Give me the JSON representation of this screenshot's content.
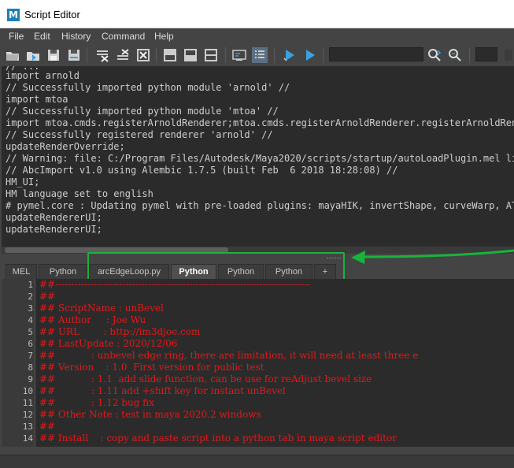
{
  "window": {
    "title": "Script Editor",
    "app_icon": "M"
  },
  "menu": [
    "File",
    "Edit",
    "History",
    "Command",
    "Help"
  ],
  "toolbar": {
    "icons": [
      "open-script-icon",
      "source-script-icon",
      "save-script-icon",
      "save-to-shelf-icon",
      "clear-history-icon",
      "clear-input-icon",
      "clear-all-icon",
      "show-history-icon",
      "show-input-icon",
      "show-both-icon",
      "echo-all-commands-icon",
      "line-numbers-icon",
      "execute-all-icon",
      "execute-icon",
      "search-icon",
      "search-next-icon"
    ],
    "search_value": "",
    "goto_value": ""
  },
  "output_lines": [
    "// ...",
    "import arnold",
    "// Successfully imported python module 'arnold' //",
    "import mtoa",
    "// Successfully imported python module 'mtoa' //",
    "import mtoa.cmds.registerArnoldRenderer;mtoa.cmds.registerArnoldRenderer.registerArnoldRender",
    "// Successfully registered renderer 'arnold' //",
    "updateRenderOverride;",
    "// Warning: file: C:/Program Files/Autodesk/Maya2020/scripts/startup/autoLoadPlugin.mel line",
    "// AbcImport v1.0 using Alembic 1.7.5 (built Feb  6 2018 18:28:08) //",
    "HM_UI;",
    "HM language set to english",
    "# pymel.core : Updating pymel with pre-loaded plugins: mayaHIK, invertShape, curveWarp, ATFP",
    "updateRendererUI;",
    "updateRendererUI;"
  ],
  "tabs": [
    {
      "label": "MEL",
      "active": false
    },
    {
      "label": "Python",
      "active": false
    },
    {
      "label": "arcEdgeLoop.py",
      "active": false
    },
    {
      "label": "Python",
      "active": true
    },
    {
      "label": "Python",
      "active": false
    },
    {
      "label": "Python",
      "active": false
    },
    {
      "label": "+",
      "active": false
    }
  ],
  "editor": {
    "line_numbers": [
      "1",
      "2",
      "3",
      "4",
      "5",
      "6",
      "7",
      "8",
      "9",
      "10",
      "11",
      "12",
      "13",
      "14"
    ],
    "lines": [
      "##--------------------------------------------------------------------------------",
      "##",
      "## ScriptName : unBevel",
      "## Author     : Joe Wu",
      "## URL        : http://im3djoe.com",
      "## LastUpdate : 2020/12/06",
      "##            : unbevel edge ring, there are limitation, it will need at least three e",
      "## Version    : 1.0  First version for public test",
      "##            : 1.1  add slide function, can be use for reAdjust bevel size",
      "##            : 1.11 add +shift key for instant unBevel",
      "##            : 1.12 bug fix",
      "## Other Note : test in maya 2020.2 windows",
      "##",
      "## Install    : copy and paste script into a python tab in maya script editor"
    ]
  },
  "colors": {
    "highlight": "#19b33c",
    "code_text": "#e31919",
    "output_text": "#cfcfcf",
    "app_icon": "#1d7fb5"
  }
}
